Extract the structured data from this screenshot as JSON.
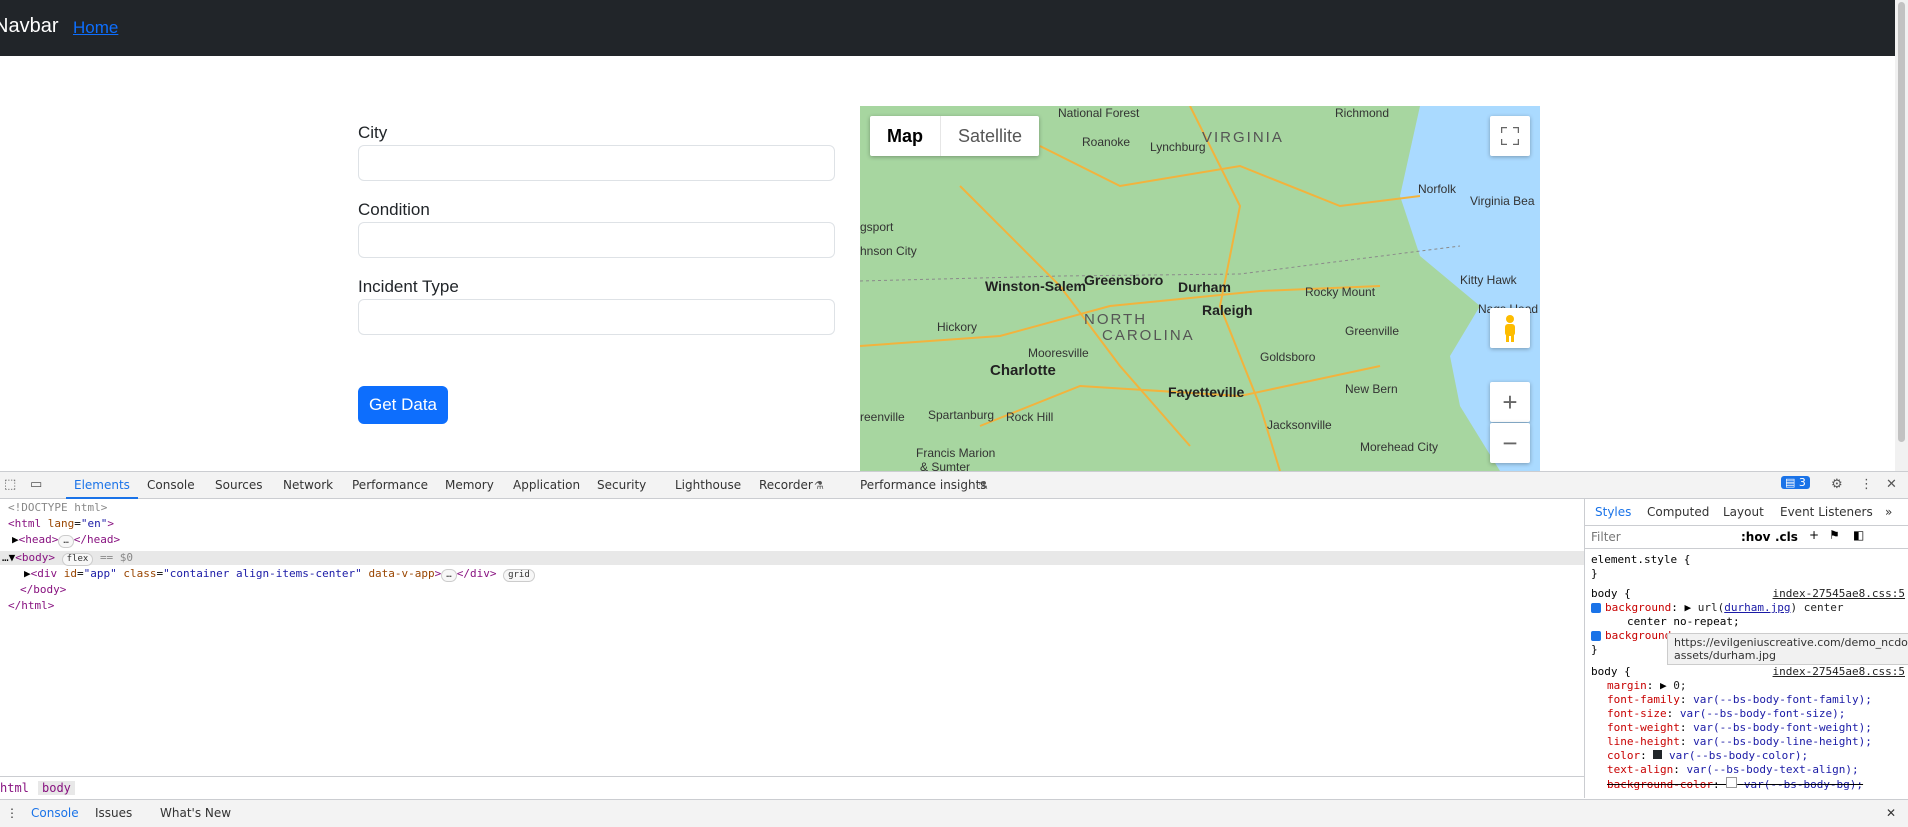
{
  "navbar": {
    "brand": "Navbar",
    "home": "Home"
  },
  "form": {
    "city_label": "City",
    "condition_label": "Condition",
    "incident_type_label": "Incident Type",
    "city_value": "",
    "condition_value": "",
    "incident_type_value": "",
    "submit_label": "Get Data"
  },
  "map": {
    "type_map": "Map",
    "type_satellite": "Satellite",
    "zoom_in": "+",
    "zoom_out": "−",
    "labels": [
      "National Forest",
      "Richmond",
      "VIRGINIA",
      "Roanoke",
      "Lynchburg",
      "Norfolk",
      "Virginia Bea",
      "gsport",
      "hnson City",
      "Winston-Salem",
      "Greensboro",
      "Durham",
      "Rocky Mount",
      "Kitty Hawk",
      "Hickory",
      "Raleigh",
      "NORTH",
      "CAROLINA",
      "Greenville",
      "Nags Head",
      "Mooresville",
      "Goldsboro",
      "Charlotte",
      "Fayetteville",
      "New Bern",
      "reenville",
      "Spartanburg",
      "Rock Hill",
      "Jacksonville",
      "Francis Marion",
      "& Sumter",
      "Morehead City"
    ]
  },
  "devtools": {
    "tabs": [
      "Elements",
      "Console",
      "Sources",
      "Network",
      "Performance",
      "Memory",
      "Application",
      "Security",
      "Lighthouse",
      "Recorder",
      "Performance insights"
    ],
    "issues_count": "3",
    "dom": {
      "doctype": "<!DOCTYPE html>",
      "html_open": "<html",
      "html_attr": "lang",
      "html_val": "\"en\"",
      "head": "<head>",
      "head_close": "</head>",
      "body": "<body>",
      "body_badge": "flex",
      "body_eq": "== $0",
      "div_open": "<div",
      "div_id_attr": "id",
      "div_id_val": "\"app\"",
      "div_class_attr": "class",
      "div_class_val": "\"container align-items-center\"",
      "div_data_attr": "data-v-app",
      "div_close": "</div>",
      "div_badge": "grid",
      "body_close": "</body>",
      "html_close": "</html>"
    },
    "breadcrumbs": [
      "html",
      "body"
    ],
    "styles": {
      "tabs": [
        "Styles",
        "Computed",
        "Layout",
        "Event Listeners"
      ],
      "filter_placeholder": "Filter",
      "hov": ":hov",
      "cls": ".cls",
      "element_style": "element.style {",
      "close_brace": "}",
      "rule1_selector": "body {",
      "rule1_source": "index-27545ae8.css:5",
      "rule1_prop1": "background",
      "rule1_val1a": "url(",
      "rule1_val1_link": "durham.jpg",
      "rule1_val1b": ") center",
      "rule1_val1c": "center no-repeat;",
      "rule1_prop2": "background",
      "tooltip_line1": "https://evilgeniuscreative.com/demo_ncdot/",
      "tooltip_line2": "assets/durham.jpg",
      "rule2_selector": "body {",
      "rule2_source": "index-27545ae8.css:5",
      "props": [
        {
          "name": "margin",
          "value": "0;"
        },
        {
          "name": "font-family",
          "value": "var(--bs-body-font-family);"
        },
        {
          "name": "font-size",
          "value": "var(--bs-body-font-size);"
        },
        {
          "name": "font-weight",
          "value": "var(--bs-body-font-weight);"
        },
        {
          "name": "line-height",
          "value": "var(--bs-body-line-height);"
        },
        {
          "name": "color",
          "value": "var(--bs-body-color);"
        },
        {
          "name": "text-align",
          "value": "var(--bs-body-text-align);"
        },
        {
          "name": "background-color",
          "value": "var(--bs-body-bg);"
        }
      ]
    },
    "drawer_tabs": [
      "Console",
      "Issues",
      "What's New"
    ]
  }
}
